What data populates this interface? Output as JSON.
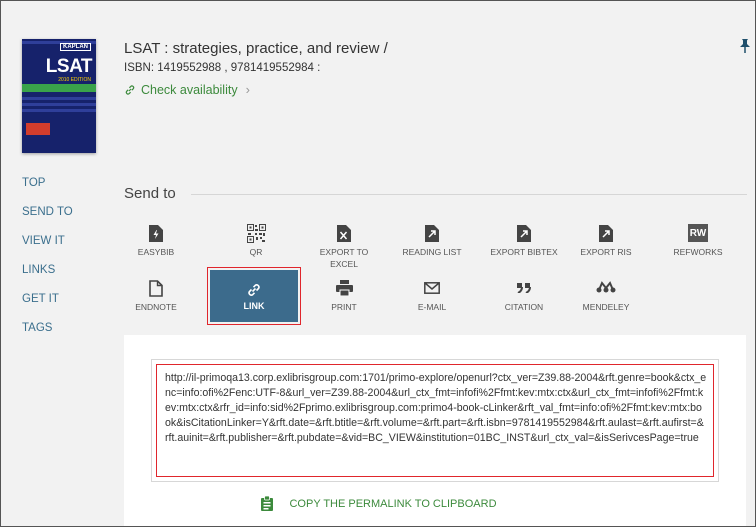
{
  "record": {
    "title": "LSAT : strategies, practice, and review /",
    "isbn": "ISBN: 1419552988 , 9781419552984 :",
    "check_availability": "Check availability",
    "cover": {
      "brand": "KAPLAN",
      "title": "LSAT",
      "edition": "2010 EDITION",
      "colors": {
        "background": "#16226b",
        "band": "#3aa34a",
        "tag": "#d23d2c"
      }
    }
  },
  "nav": {
    "items": [
      "TOP",
      "SEND TO",
      "VIEW IT",
      "LINKS",
      "GET IT",
      "TAGS"
    ],
    "color": "#3b6f8d"
  },
  "send_to": {
    "title": "Send to",
    "actions": [
      {
        "label": "EASYBIB",
        "icon": "document-bolt-icon"
      },
      {
        "label": "QR",
        "icon": "qr-code-icon"
      },
      {
        "label": "EXPORT TO",
        "label2": "EXCEL",
        "icon": "excel-file-icon"
      },
      {
        "label": "READING LIST",
        "icon": "reading-list-icon"
      },
      {
        "label": "EXPORT BIBTEX",
        "icon": "export-bibtex-icon"
      },
      {
        "label": "EXPORT RIS",
        "icon": "export-ris-icon"
      },
      {
        "label": "REFWORKS",
        "icon": "refworks-icon",
        "badge": "RW"
      },
      {
        "label": "ENDNOTE",
        "icon": "endnote-icon"
      },
      {
        "label": "LINK",
        "icon": "link-icon",
        "selected": true
      },
      {
        "label": "PRINT",
        "icon": "printer-icon"
      },
      {
        "label": "E-MAIL",
        "icon": "email-icon"
      },
      {
        "label": "CITATION",
        "icon": "quote-icon"
      },
      {
        "label": "MENDELEY",
        "icon": "mendeley-icon"
      }
    ]
  },
  "permalink": {
    "url": "http://il-primoqa13.corp.exlibrisgroup.com:1701/primo-explore/openurl?ctx_ver=Z39.88-2004&rft.genre=book&ctx_enc=info:ofi%2Fenc:UTF-8&url_ver=Z39.88-2004&url_ctx_fmt=infofi%2Ffmt:kev:mtx:ctx&url_ctx_fmt=infofi%2Ffmt:kev:mtx:ctx&rfr_id=info:sid%2Fprimo.exlibrisgroup.com:primo4-book-cLinker&rft_val_fmt=info:ofi%2Ffmt:kev:mtx:book&isCitationLinker=Y&rft.date=&rft.btitle=&rft.volume=&rft.part=&rft.isbn=9781419552984&rft.aulast=&rft.aufirst=&rft.auinit=&rft.publisher=&rft.pubdate=&vid=BC_VIEW&institution=01BC_INST&url_ctx_val=&isSerivcesPage=true",
    "copy_label": "COPY THE PERMALINK TO CLIPBOARD"
  },
  "colors": {
    "accent_green": "#3c8a3c",
    "selected_tile": "#3c6b8c",
    "highlight_red": "#e0262c",
    "background": "#f2f2f2"
  }
}
